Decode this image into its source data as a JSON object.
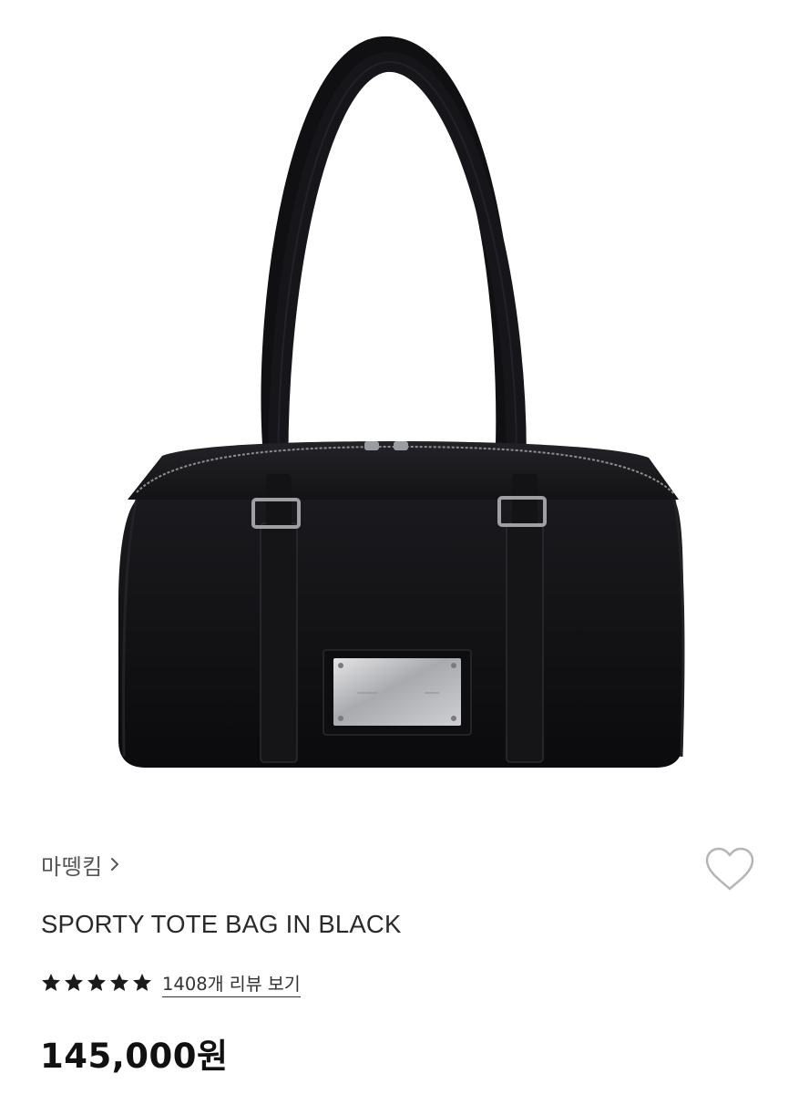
{
  "product": {
    "image_icon": "product-photo-black-tote-bag",
    "brand": "마뗑킴",
    "brand_chevron_icon": "chevron-right-icon",
    "wishlist_icon": "heart-outline-icon",
    "title": "SPORTY TOTE BAG IN BLACK",
    "rating": {
      "stars": 5,
      "max_stars": 5,
      "review_link": "1408개 리뷰 보기"
    },
    "price": "145,000원"
  },
  "colors": {
    "bag_body": "#111114",
    "star": "#1a1a1a",
    "heart_outline": "#b5b5b5",
    "brand_text": "#555555"
  }
}
